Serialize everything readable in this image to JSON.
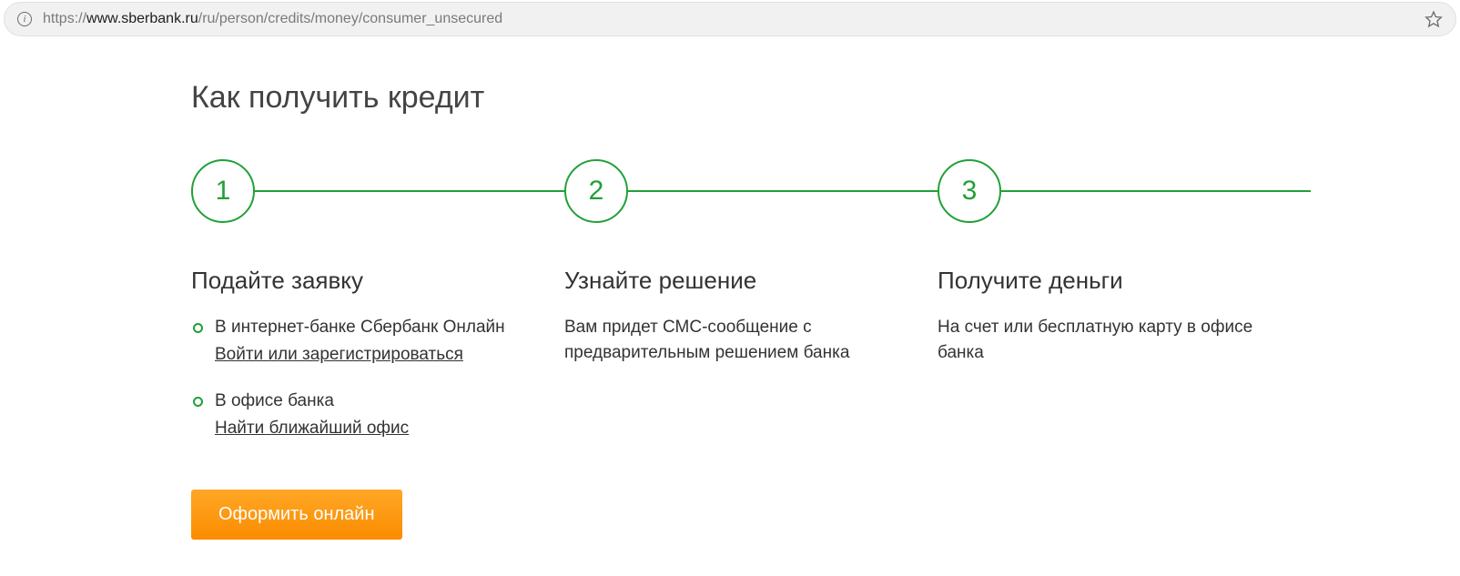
{
  "browser": {
    "url_prefix": "https://",
    "url_host": "www.sberbank.ru",
    "url_path": "/ru/person/credits/money/consumer_unsecured"
  },
  "heading": "Как получить кредит",
  "steps": [
    {
      "num": "1",
      "title": "Подайте заявку",
      "bullets": [
        {
          "text": "В интернет-банке Сбербанк Онлайн",
          "link": "Войти или зарегистрироваться"
        },
        {
          "text": "В офисе банка",
          "link": "Найти ближайший офис"
        }
      ]
    },
    {
      "num": "2",
      "title": "Узнайте решение",
      "text": "Вам придет СМС-сообщение с предварительным решением банка"
    },
    {
      "num": "3",
      "title": "Получите деньги",
      "text": "На счет или бесплатную карту в офисе банка"
    }
  ],
  "cta_label": "Оформить онлайн",
  "colors": {
    "accent": "#21a038",
    "cta": "#fb8c00"
  }
}
